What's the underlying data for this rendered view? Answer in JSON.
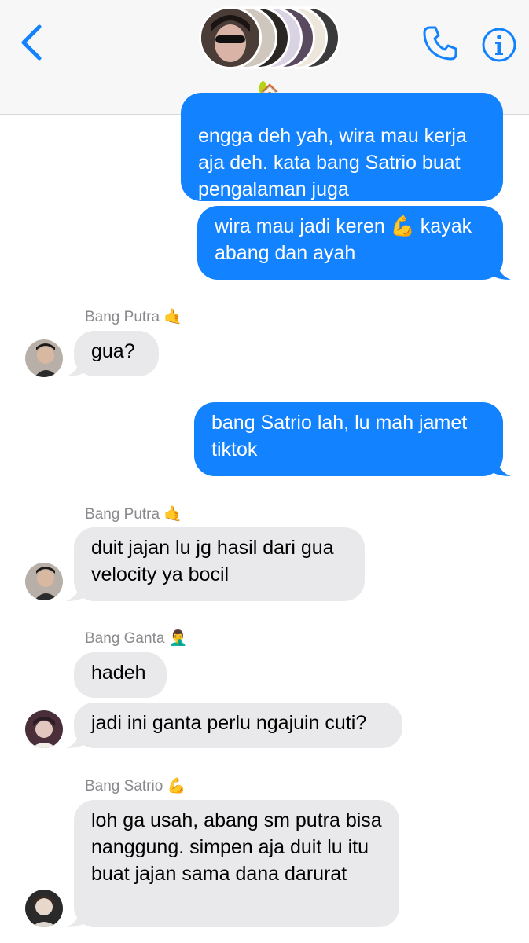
{
  "header": {
    "group_emoji": "🏡",
    "avatar_colors": [
      "#cfc7bd",
      "#2a2624",
      "#d9d3e3",
      "#5a4a60",
      "#ede6da",
      "#3b3b3b"
    ]
  },
  "messages": {
    "m1": "engga deh yah, wira mau kerja aja deh. kata bang Satrio buat pengalaman juga",
    "m2_a": "wira mau jadi keren ",
    "m2_emoji": "💪",
    "m2_b": " kayak abang dan ayah",
    "sender1": "Bang Putra",
    "sender1_emoji": "🤙",
    "m3": "gua?",
    "m4": "bang Satrio lah, lu mah jamet tiktok",
    "sender2": "Bang Putra",
    "sender2_emoji": "🤙",
    "m5": "duit jajan lu jg hasil dari gua velocity ya bocil",
    "sender3": "Bang Ganta",
    "sender3_emoji": "🤦‍♂️",
    "m6": "hadeh",
    "m7": "jadi ini ganta perlu ngajuin cuti?",
    "sender4": "Bang Satrio",
    "sender4_emoji": "💪",
    "m8": "loh ga usah, abang sm putra bisa nanggung. simpen aja duit lu itu buat jajan sama dana darurat"
  },
  "colors": {
    "accent": "#1282fe",
    "incoming": "#e9e9eb"
  }
}
